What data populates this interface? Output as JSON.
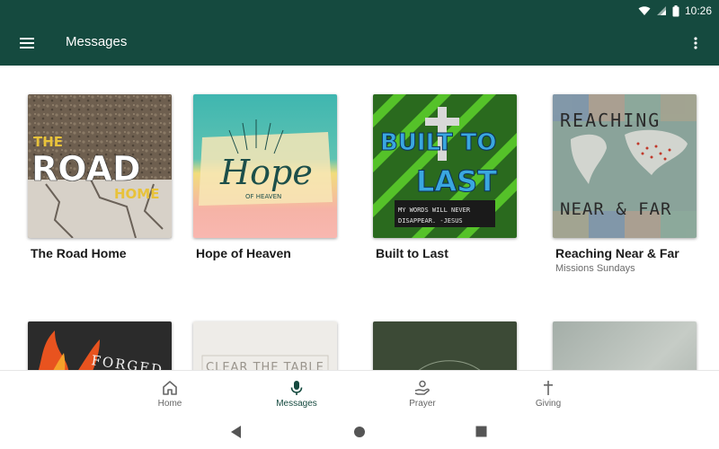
{
  "status_bar": {
    "time": "10:26"
  },
  "app_bar": {
    "title": "Messages"
  },
  "cards": [
    {
      "title": "The Road Home",
      "subtitle": "",
      "art": {
        "line1": "THE",
        "line2": "ROAD",
        "line3": "HOME"
      }
    },
    {
      "title": "Hope of Heaven",
      "subtitle": "",
      "art": {
        "line1": "Hope",
        "line2": "OF HEAVEN"
      }
    },
    {
      "title": "Built to Last",
      "subtitle": "",
      "art": {
        "line1": "BUILT TO",
        "line2": "LAST",
        "line3": "MY WORDS WILL NEVER",
        "line4": "DISAPPEAR. -JESUS"
      }
    },
    {
      "title": "Reaching Near & Far",
      "subtitle": "Missions Sundays",
      "art": {
        "line1": "REACHING",
        "line2": "NEAR & FAR"
      }
    },
    {
      "title": "",
      "subtitle": "",
      "art": {
        "line1": "FORGED"
      }
    },
    {
      "title": "",
      "subtitle": "",
      "art": {
        "line1": "CLEAR THE TABLE"
      }
    },
    {
      "title": "",
      "subtitle": "",
      "art": {}
    },
    {
      "title": "",
      "subtitle": "",
      "art": {}
    }
  ],
  "bottom_nav": [
    {
      "label": "Home",
      "icon": "home-icon",
      "active": false
    },
    {
      "label": "Messages",
      "icon": "microphone-icon",
      "active": true
    },
    {
      "label": "Prayer",
      "icon": "prayer-hands-icon",
      "active": false
    },
    {
      "label": "Giving",
      "icon": "cross-icon",
      "active": false
    }
  ],
  "colors": {
    "primary": "#154a3f",
    "accent": "#154a3f"
  }
}
